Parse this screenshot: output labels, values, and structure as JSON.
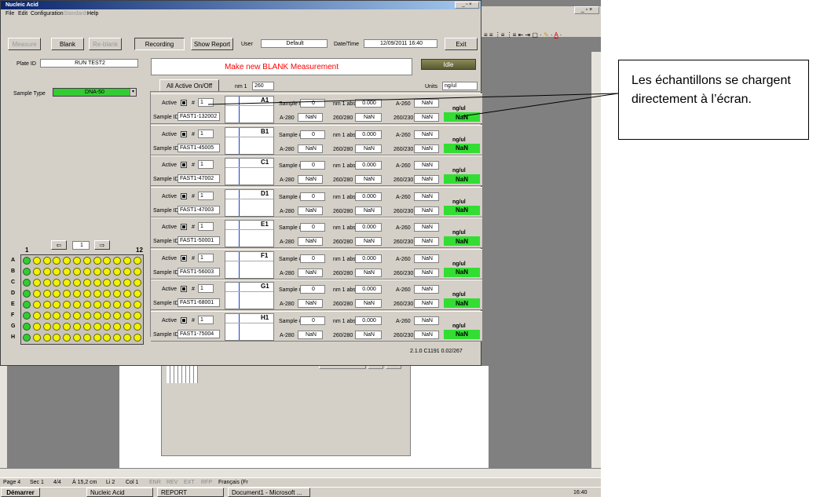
{
  "window": {
    "title": "Nucleic Acid"
  },
  "menu": [
    "File",
    "Edit",
    "Configuration",
    "Standards",
    "Help"
  ],
  "toolbar": {
    "measure": "Measure",
    "blank": "Blank",
    "reblank": "Re-blank",
    "recording": "Recording",
    "show_report": "Show Report",
    "user_label": "User",
    "user_value": "Default",
    "datetime_label": "Date/Time",
    "datetime_value": "12/09/2011 16:40",
    "exit": "Exit"
  },
  "plate": {
    "label": "Plate ID",
    "value": "RUN TEST2"
  },
  "banner": "Make new BLANK Measurement",
  "status": "Idle",
  "sample_type": {
    "label": "Sample Type",
    "value": "DNA-50"
  },
  "controls": {
    "all_active": "All Active On/Off",
    "nm_label": "nm 1",
    "nm_value": "260",
    "units_label": "Units",
    "units_value": "ng/ul"
  },
  "plate_nav": {
    "first_col": "1",
    "last_col": "12",
    "current": "1"
  },
  "plate_rows": [
    "A",
    "B",
    "C",
    "D",
    "E",
    "F",
    "G",
    "H"
  ],
  "samples": [
    {
      "well": "A1",
      "sample_id": "FAST1-132002",
      "num": "1",
      "sample_num": "0",
      "abs": "0.000",
      "a280": "NaN",
      "r260_280": "NaN",
      "a260": "NaN",
      "r260_230": "NaN",
      "conc": "NaN"
    },
    {
      "well": "B1",
      "sample_id": "FAST1-45005",
      "num": "1",
      "sample_num": "0",
      "abs": "0.000",
      "a280": "NaN",
      "r260_280": "NaN",
      "a260": "NaN",
      "r260_230": "NaN",
      "conc": "NaN"
    },
    {
      "well": "C1",
      "sample_id": "FAST1-47002",
      "num": "1",
      "sample_num": "0",
      "abs": "0.000",
      "a280": "NaN",
      "r260_280": "NaN",
      "a260": "NaN",
      "r260_230": "NaN",
      "conc": "NaN"
    },
    {
      "well": "D1",
      "sample_id": "FAST1-47003",
      "num": "1",
      "sample_num": "0",
      "abs": "0.000",
      "a280": "NaN",
      "r260_280": "NaN",
      "a260": "NaN",
      "r260_230": "NaN",
      "conc": "NaN"
    },
    {
      "well": "E1",
      "sample_id": "FAST1-50001",
      "num": "1",
      "sample_num": "0",
      "abs": "0.000",
      "a280": "NaN",
      "r260_280": "NaN",
      "a260": "NaN",
      "r260_230": "NaN",
      "conc": "NaN"
    },
    {
      "well": "F1",
      "sample_id": "FAST1-56003",
      "num": "1",
      "sample_num": "0",
      "abs": "0.000",
      "a280": "NaN",
      "r260_280": "NaN",
      "a260": "NaN",
      "r260_230": "NaN",
      "conc": "NaN"
    },
    {
      "well": "G1",
      "sample_id": "FAST1-68001",
      "num": "1",
      "sample_num": "0",
      "abs": "0.000",
      "a280": "NaN",
      "r260_280": "NaN",
      "a260": "NaN",
      "r260_230": "NaN",
      "conc": "NaN"
    },
    {
      "well": "H1",
      "sample_id": "FAST1-75004",
      "num": "1",
      "sample_num": "0",
      "abs": "0.000",
      "a280": "NaN",
      "r260_280": "NaN",
      "a260": "NaN",
      "r260_230": "NaN",
      "conc": "NaN"
    }
  ],
  "sample_labels": {
    "active": "Active",
    "hash": "#",
    "sample_id": "Sample ID",
    "sample_num": "Sample #",
    "abs": "nm 1 abs.",
    "a280": "A-280",
    "r260_280": "260/280",
    "a260": "A-260",
    "r260_230": "260/230",
    "unit": "ng/ul"
  },
  "version": "2.1.0 C1191 0.02/267",
  "callout": "Les échantillons se chargent directement à l’écran.",
  "word_status": {
    "page": "Page 4",
    "sec": "Sec 1",
    "pages": "4/4",
    "at": "À 15,2 cm",
    "line": "Li 2",
    "col": "Col 1",
    "rec": "ENR",
    "rev": "REV",
    "ext": "EXT",
    "ovr": "RFP",
    "lang": "Français (Fr"
  },
  "taskbar": {
    "start": "Démarrer",
    "nucleic": "Nucleic Acid",
    "report": "REPORT",
    "doc": "Document1 - Microsoft ...",
    "clock": "16:40"
  },
  "colors": {
    "titlebar": "#0a246a",
    "banner_text": "#ff0000",
    "nan_green": "#33dd33",
    "well": "#f2f200",
    "sample_type": "#33cc33"
  }
}
